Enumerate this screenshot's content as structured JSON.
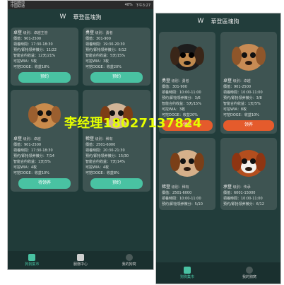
{
  "left": {
    "status": {
      "carrier1": "中国移动",
      "carrier2": "中国联通",
      "battery": "48%",
      "time": "下午3:27"
    },
    "app_title": "華登區塊狗",
    "cards": [
      {
        "name": "卓登",
        "level_label": "级别：",
        "level_value": "卓越主管",
        "price": "價值：901-2500",
        "time": "領養時間：17:30-18:30",
        "reserve": "预约/即抢领养微分：11/22",
        "contract": "智能合约收益：12天/21%",
        "wia": "可挖WIA：5枚",
        "doge": "可挖DOGE：收益18%",
        "button": "预约"
      },
      {
        "name": "勇登",
        "level_label": "级别：",
        "level_value": "勇者",
        "price": "價值：301-900",
        "time": "領養時間：19:30-20:30",
        "reserve": "预约/即抢领养微分：6/12",
        "contract": "智能合约收益：5天/15%",
        "wia": "可挖WIA：3枚",
        "doge": "可挖DOGE：收益20%",
        "button": "预约"
      },
      {
        "name": "卓登",
        "level_label": "级别：",
        "level_value": "卓越",
        "price": "價值：901-2500",
        "time": "領養時間：17:30-18:30",
        "reserve": "预约/即抢领养微分：7/14",
        "contract": "智能合约收益：1天/5%",
        "wia": "可挖WIA：4枚",
        "doge": "可挖DOGE：收益10%",
        "button": "待领养"
      },
      {
        "name": "稀登",
        "level_label": "级别：",
        "level_value": "稀有",
        "price": "價值：2501-6000",
        "time": "領養時間：20:30-21:30",
        "reserve": "预约/即抢领养微分：15/30",
        "contract": "智能合约收益：7天/14%",
        "wia": "可挖WIA：4枚",
        "doge": "可挖DOGE：收益8%",
        "button": "预约"
      }
    ],
    "tabs": [
      {
        "label": "狗狗集市"
      },
      {
        "label": "服務中心"
      },
      {
        "label": "我的狗窝"
      }
    ]
  },
  "right": {
    "app_title": "華登區塊狗",
    "cards": [
      {
        "name": "勇登",
        "level_label": "级别：",
        "level_value": "勇者",
        "price": "價值：301-900",
        "time": "領養時間：10:00-11:00",
        "reserve": "预约/即抢领养微分：3/6",
        "contract": "智能合约收益：5天/15%",
        "wia": "可挖WIA：3枚",
        "doge": "可挖DOGE：收益20%",
        "button": "领养"
      },
      {
        "name": "卓登",
        "level_label": "级别：",
        "level_value": "卓越",
        "price": "價值：901-2500",
        "time": "領養時間：10:00-11:00",
        "reserve": "预约/即抢领养微分：3/8",
        "contract": "智能合约收益：1天/5%",
        "wia": "可挖WIA：8枚",
        "doge": "可挖DOGE：收益10%",
        "button": "领养"
      },
      {
        "name": "稀登",
        "level_label": "级别：",
        "level_value": "稀有",
        "price": "價值：2501-6000",
        "time": "領養時間：10:00-11:00",
        "reserve": "预约/即抢领养微分：5/10",
        "button": ""
      },
      {
        "name": "承登",
        "level_label": "级别：",
        "level_value": "传承",
        "price": "價值：6001-15000",
        "time": "領養時間：10:00-11:00",
        "reserve": "预约/即抢领养微分：6/12",
        "button": ""
      }
    ],
    "tabs": [
      {
        "label": "狗狗集市"
      },
      {
        "label": "我的狗窝"
      }
    ]
  },
  "overlay": {
    "text": "李经理18027137824"
  }
}
